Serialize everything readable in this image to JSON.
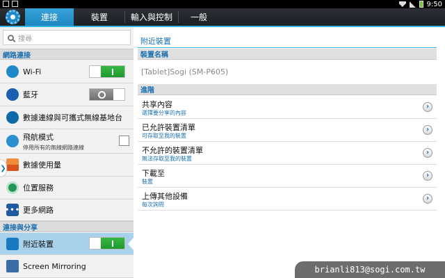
{
  "status_bar": {
    "time": "9:50"
  },
  "tabs": [
    {
      "label": "連接",
      "active": true
    },
    {
      "label": "裝置",
      "active": false
    },
    {
      "label": "輸入與控制",
      "active": false
    },
    {
      "label": "一般",
      "active": false
    }
  ],
  "search": {
    "placeholder": "搜尋"
  },
  "left": {
    "section1": "網路連接",
    "wifi": {
      "label": "Wi-Fi",
      "toggle": "on"
    },
    "bluetooth": {
      "label": "藍牙",
      "toggle": "off"
    },
    "tethering": {
      "label": "數據連線與可攜式無線基地台"
    },
    "airplane": {
      "label": "飛航模式",
      "sub": "停用所有的無線網路連線",
      "checked": false
    },
    "data_usage": {
      "label": "數據使用量"
    },
    "location": {
      "label": "位置服務"
    },
    "more": {
      "label": "更多網路",
      "icon_glyph": "•••"
    },
    "section2": "連接與分享",
    "nearby": {
      "label": "附近裝置",
      "toggle": "on"
    },
    "mirroring": {
      "label": "Screen Mirroring"
    }
  },
  "right": {
    "title": "附近裝置",
    "device_header": "裝置名稱",
    "device_name": "[Tablet]Sogi (SM-P605)",
    "advanced_header": "進階",
    "rows": [
      {
        "title": "共享內容",
        "sub": "選擇要分享的內容"
      },
      {
        "title": "已允許裝置清單",
        "sub": "可存取至我的裝置"
      },
      {
        "title": "不允許的裝置清單",
        "sub": "無法存取至我的裝置"
      },
      {
        "title": "下載至",
        "sub": "裝置"
      },
      {
        "title": "上傳其他設備",
        "sub": "每次詢問"
      }
    ]
  },
  "watermark": "brianli813@sogi.com.tw",
  "colors": {
    "accent": "#33b5e5",
    "tab_active": "#1d86c2",
    "toggle_on": "#1f9a2e",
    "link_blue": "#1a70b0"
  }
}
